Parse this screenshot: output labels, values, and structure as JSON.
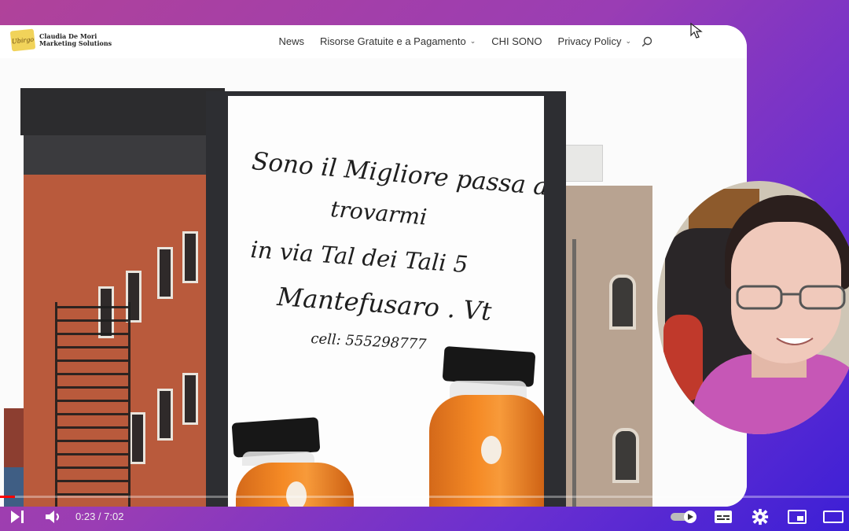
{
  "site": {
    "logo": {
      "badge_text": "Ubirgo",
      "line1": "Claudia De Mori",
      "line2": "Marketing Solutions"
    },
    "menu": [
      {
        "label": "News",
        "has_dropdown": false
      },
      {
        "label": "Risorse Gratuite e a Pagamento",
        "has_dropdown": true
      },
      {
        "label": "CHI SONO",
        "has_dropdown": false
      },
      {
        "label": "Privacy Policy",
        "has_dropdown": true
      }
    ],
    "search_icon": "search-icon"
  },
  "billboard": {
    "line1": "Sono il Migliore passa a",
    "line2": "trovarmi",
    "line3": "in  via Tal dei Tali 5",
    "line4": "Mantefusaro . Vt",
    "line5": "cell: 555298777"
  },
  "player": {
    "current_time": "0:23",
    "duration": "7:02",
    "time_display": "0:23 / 7:02",
    "progress_fraction": 0.054,
    "colors": {
      "progress": "#ff0000",
      "controls": "#ffffff"
    },
    "icons": [
      "next-icon",
      "volume-icon",
      "autoplay-toggle-icon",
      "subtitles-icon",
      "settings-gear-icon",
      "miniplayer-icon",
      "theater-mode-icon"
    ]
  },
  "colors": {
    "background_gradient_start": "#b0429a",
    "background_gradient_end": "#3c1fd6",
    "juice": "#f58a25",
    "brick": "#b95a3c"
  }
}
